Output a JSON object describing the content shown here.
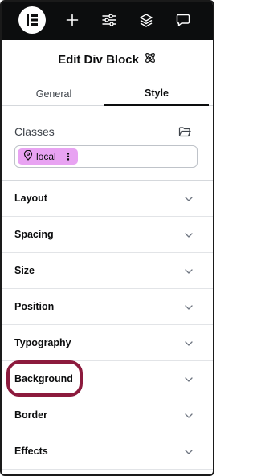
{
  "toolbar": {
    "items": [
      {
        "name": "elementor-logo",
        "icon": "elementor-logo-icon"
      },
      {
        "name": "add",
        "icon": "plus-icon"
      },
      {
        "name": "site-settings",
        "icon": "sliders-icon"
      },
      {
        "name": "structure",
        "icon": "layers-icon"
      },
      {
        "name": "notes",
        "icon": "comment-icon"
      }
    ]
  },
  "header": {
    "title": "Edit Div Block",
    "title_icon": "atom-icon"
  },
  "tabs": [
    {
      "label": "General",
      "active": false
    },
    {
      "label": "Style",
      "active": true
    }
  ],
  "classes": {
    "label": "Classes",
    "manager_icon": "folder-icon",
    "chip": {
      "label": "local",
      "icon": "map-pin-icon",
      "menu_icon": "more-vertical-icon"
    }
  },
  "sections": [
    {
      "label": "Layout"
    },
    {
      "label": "Spacing"
    },
    {
      "label": "Size"
    },
    {
      "label": "Position"
    },
    {
      "label": "Typography"
    },
    {
      "label": "Background"
    },
    {
      "label": "Border"
    },
    {
      "label": "Effects"
    }
  ],
  "colors": {
    "toolbar_bg": "#0c0d0e",
    "chip_bg": "#e8a3f2",
    "highlight": "#8c1a3d"
  }
}
